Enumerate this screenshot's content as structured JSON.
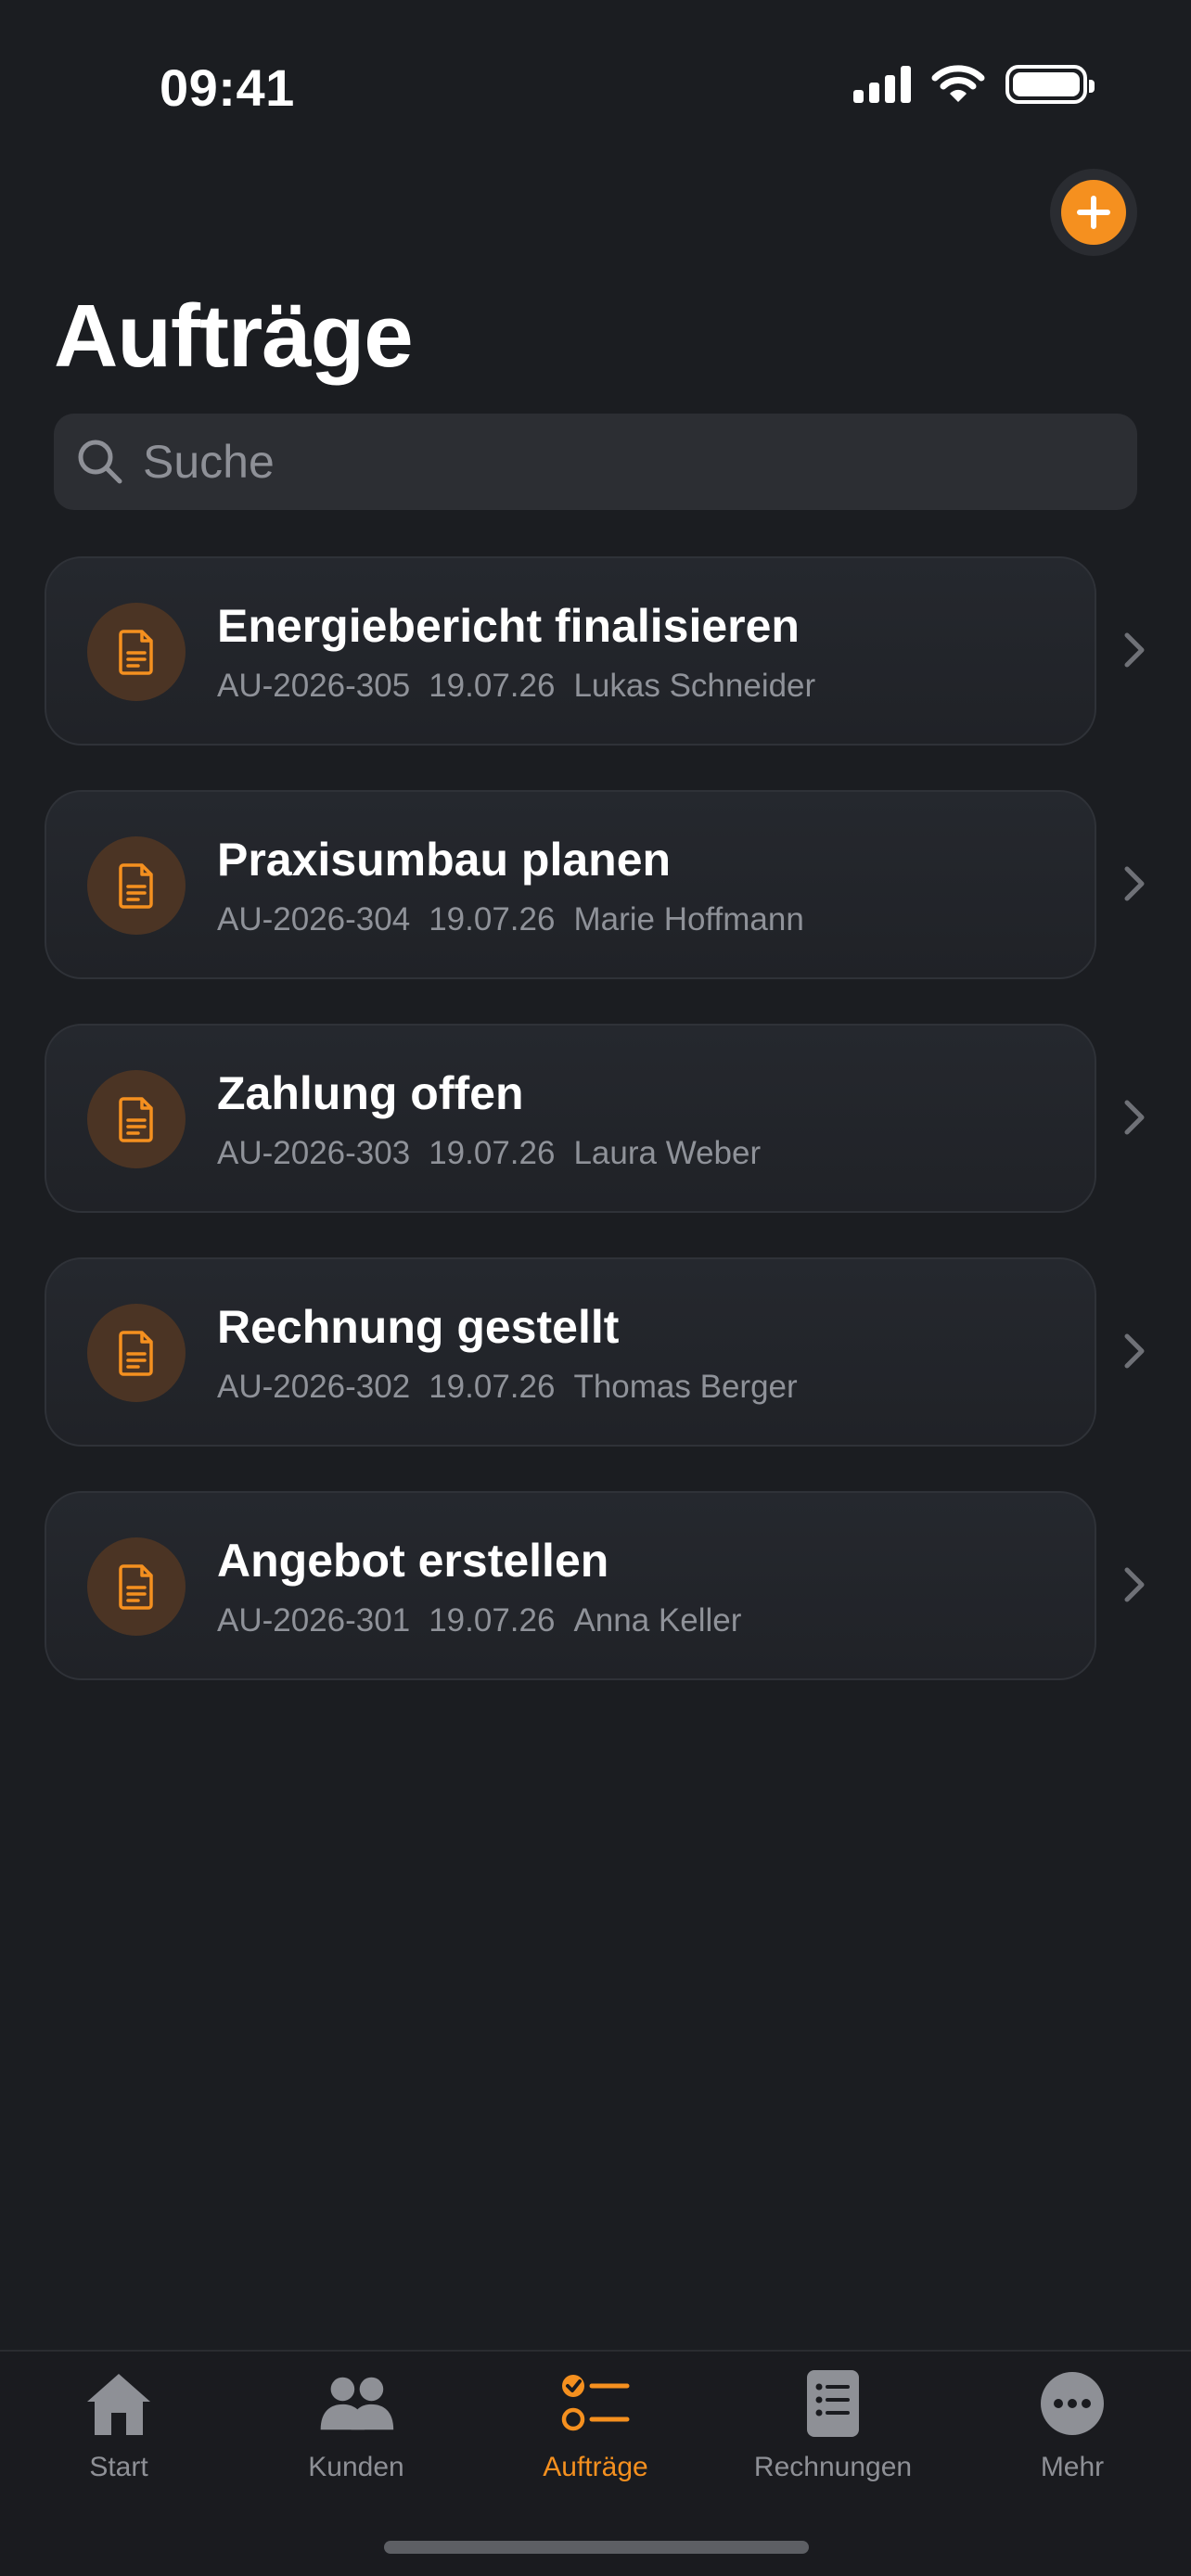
{
  "status_bar": {
    "time": "09:41"
  },
  "header": {
    "title": "Aufträge",
    "add_icon": "plus-icon"
  },
  "search": {
    "placeholder": "Suche",
    "icon": "search-icon"
  },
  "orders": [
    {
      "title": "Energiebericht finalisieren",
      "number": "AU-2026-305",
      "date": "19.07.26",
      "customer": "Lukas Schneider"
    },
    {
      "title": "Praxisumbau planen",
      "number": "AU-2026-304",
      "date": "19.07.26",
      "customer": "Marie Hoffmann"
    },
    {
      "title": "Zahlung offen",
      "number": "AU-2026-303",
      "date": "19.07.26",
      "customer": "Laura Weber"
    },
    {
      "title": "Rechnung gestellt",
      "number": "AU-2026-302",
      "date": "19.07.26",
      "customer": "Thomas Berger"
    },
    {
      "title": "Angebot erstellen",
      "number": "AU-2026-301",
      "date": "19.07.26",
      "customer": "Anna Keller"
    }
  ],
  "tabs": [
    {
      "label": "Start",
      "icon": "home-icon",
      "active": false
    },
    {
      "label": "Kunden",
      "icon": "people-icon",
      "active": false
    },
    {
      "label": "Aufträge",
      "icon": "checklist-icon",
      "active": true
    },
    {
      "label": "Rechnungen",
      "icon": "invoice-icon",
      "active": false
    },
    {
      "label": "Mehr",
      "icon": "more-icon",
      "active": false
    }
  ],
  "colors": {
    "accent": "#f5901f",
    "background": "#1b1d21",
    "card": "#23262b",
    "secondary_text": "#8f9299"
  }
}
